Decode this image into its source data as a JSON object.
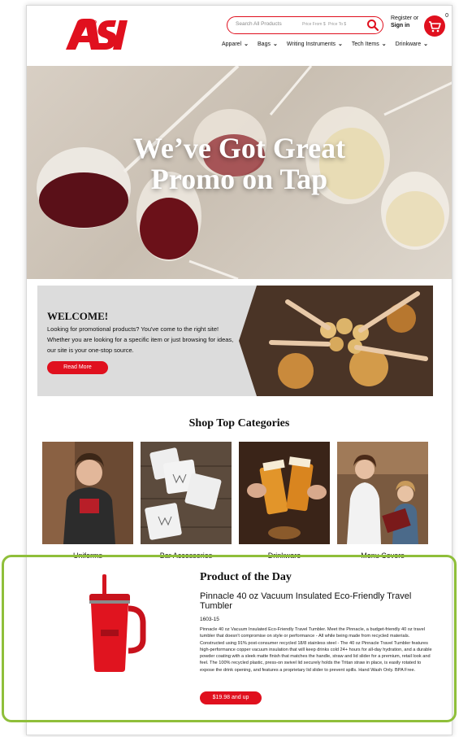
{
  "header": {
    "logo_text": "ASI",
    "search": {
      "placeholder": "Search All Products",
      "price_from": "Price From $",
      "price_to": "Price To $"
    },
    "register_label": "Register or",
    "signin_label": "Sign in",
    "cart_count": "0",
    "nav": [
      {
        "label": "Apparel"
      },
      {
        "label": "Bags"
      },
      {
        "label": "Writing Instruments"
      },
      {
        "label": "Tech Items"
      },
      {
        "label": "Drinkware"
      }
    ]
  },
  "hero": {
    "line1": "We’ve Got Great",
    "line2": "Promo on Tap"
  },
  "welcome": {
    "title": "WELCOME!",
    "body": "Looking for promotional products? You've come to the right site! Whether you are looking for a specific item or just browsing for ideas, our site is your one-stop source.",
    "button": "Read More"
  },
  "categories": {
    "title": "Shop Top Categories",
    "items": [
      {
        "label": "Uniforms"
      },
      {
        "label": "Bar Accessories"
      },
      {
        "label": "Drinkware"
      },
      {
        "label": "Menu Covers"
      }
    ]
  },
  "product_of_day": {
    "heading": "Product of the Day",
    "name": "Pinnacle 40 oz Vacuum Insulated Eco-Friendly Travel Tumbler",
    "sku": "1603-15",
    "description": "Pinnacle 40 oz Vacuum Insulated Eco-Friendly Travel Tumbler. Meet the Pinnacle, a budget-friendly 40 oz travel tumbler that doesn't compromise on style or performance - All while being made from recycled materials. Constructed using 91% post-consumer recycled 18/8 stainless steel - The 40 oz Pinnacle Travel Tumbler features high-performance copper vacuum insulation that will keep drinks cold 24+ hours for all-day hydration, and a durable powder coating with a sleek matte finish that matches the handle, straw and lid slider for a premium, retail look and feel. The 100% recycled plastic, press-on swivel lid securely holds the Tritan straw in place, is easily rotated to expose the drink opening, and features a proprietary lid slider to prevent spills. Hand Wash Only. BPA Free.",
    "price": "$19.98 and up"
  },
  "colors": {
    "brand_red": "#e0101e",
    "highlight_green": "#8fbf3a",
    "welcome_bg": "#dcdcdc"
  }
}
